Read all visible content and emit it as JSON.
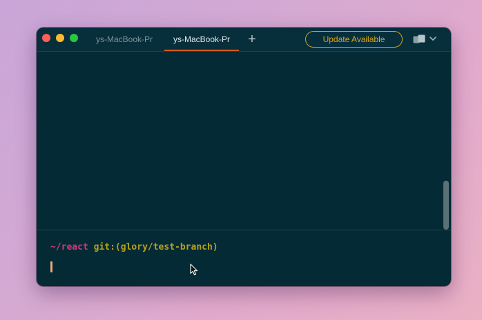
{
  "window": {
    "tabs": [
      {
        "label": "ys-MacBook-Pr",
        "active": false
      },
      {
        "label": "ys-MacBook-Pr",
        "active": true
      }
    ],
    "new_tab_label": "+",
    "update_button_label": "Update Available",
    "icons": {
      "close": "close-icon",
      "minimize": "minimize-icon",
      "maximize": "maximize-icon",
      "layout": "layout-icon",
      "chevron": "chevron-down-icon",
      "pointer": "mouse-pointer-icon"
    },
    "colors": {
      "background": "#042a35",
      "accent_tab": "#d85a1f",
      "update": "#d3a21e",
      "prompt_dir": "#d6367e",
      "prompt_git": "#b7a11d",
      "cursor": "#f0a87c"
    }
  },
  "terminal": {
    "prompt_dir": "~/react",
    "prompt_git": "git:(glory/test-branch)"
  }
}
